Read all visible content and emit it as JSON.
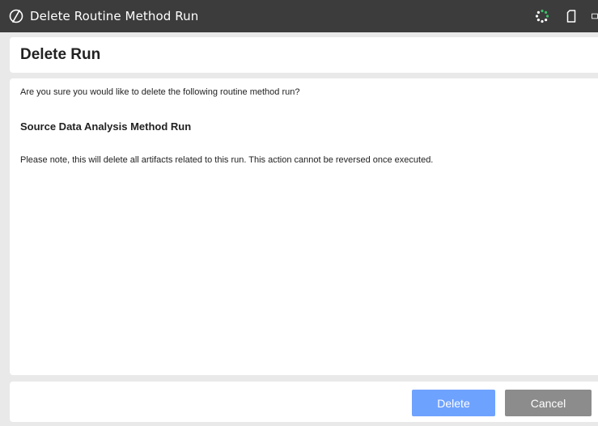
{
  "window": {
    "title": "Delete Routine Method Run",
    "app_icon": "circle-slash-icon",
    "controls": [
      "loading-spinner-icon",
      "document-icon",
      "window-icon"
    ]
  },
  "dialog": {
    "heading": "Delete Run",
    "question": "Are you sure you would like to delete the following routine method run?",
    "run_name": "Source Data Analysis Method Run",
    "note": "Please note, this will delete all artifacts related to this run. This action cannot be reversed once executed."
  },
  "footer": {
    "delete_label": "Delete",
    "cancel_label": "Cancel"
  },
  "colors": {
    "titlebar": "#3c3c3c",
    "background": "#e9e9e9",
    "delete_button": "#6ea2ff",
    "cancel_button": "#8c8c8c",
    "spinner": "#3fbf6a"
  }
}
